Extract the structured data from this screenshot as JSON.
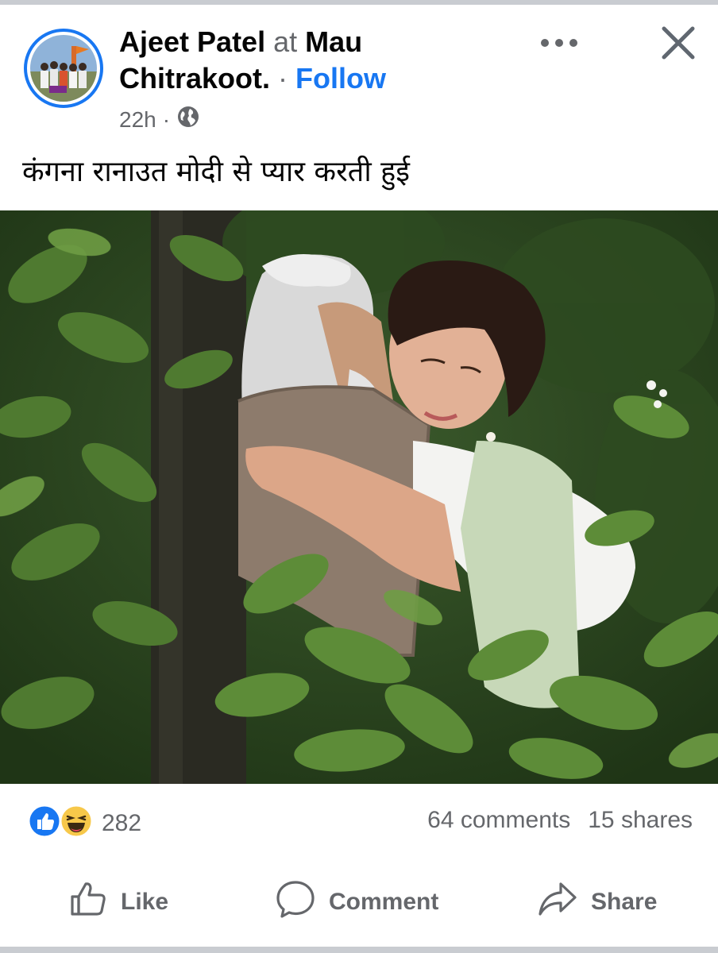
{
  "post": {
    "author": "Ajeet Patel",
    "at_word": "at",
    "location": "Mau Chitrakoot.",
    "separator": "·",
    "follow_label": "Follow",
    "time": "22h",
    "time_separator": "·",
    "caption": "कंगना रानाउत मोदी से प्यार करती हुई"
  },
  "stats": {
    "reaction_count": "282",
    "comments": "64 comments",
    "shares": "15 shares"
  },
  "actions": {
    "like_label": "Like",
    "comment_label": "Comment",
    "share_label": "Share"
  },
  "icons": {
    "more": "more-dots-icon",
    "close": "close-icon",
    "privacy": "globe-icon",
    "reaction_like": "like-reaction-icon",
    "reaction_haha": "haha-reaction-icon",
    "like": "thumbs-up-icon",
    "comment": "comment-bubble-icon",
    "share": "share-arrow-icon"
  },
  "colors": {
    "accent": "#1877f2",
    "secondary_text": "#65676b",
    "primary_text": "#050505",
    "border": "#c9ccd1"
  }
}
